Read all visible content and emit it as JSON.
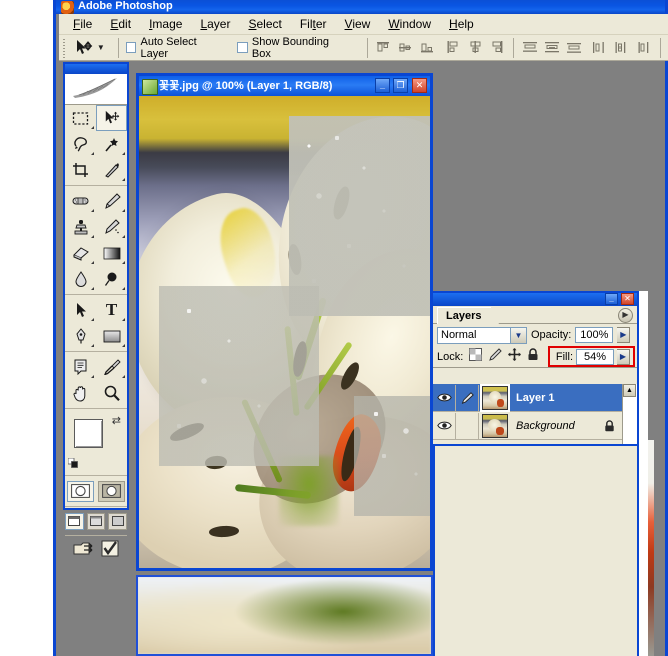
{
  "app": {
    "title": "Adobe Photoshop",
    "icon": "photoshop-logo-icon"
  },
  "menubar": {
    "items": [
      {
        "label": "File",
        "accel": "F"
      },
      {
        "label": "Edit",
        "accel": "E"
      },
      {
        "label": "Image",
        "accel": "I"
      },
      {
        "label": "Layer",
        "accel": "L"
      },
      {
        "label": "Select",
        "accel": "S"
      },
      {
        "label": "Filter",
        "accel": "t"
      },
      {
        "label": "View",
        "accel": "V"
      },
      {
        "label": "Window",
        "accel": "W"
      },
      {
        "label": "Help",
        "accel": "H"
      }
    ]
  },
  "options_bar": {
    "active_tool_icon": "move-tool-icon",
    "preset_caret": "chevron-down-icon",
    "checkboxes": [
      {
        "label": "Auto Select Layer",
        "checked": false
      },
      {
        "label": "Show Bounding Box",
        "checked": false
      }
    ],
    "align_group_1": [
      "align-top-edges",
      "align-vertical-centers",
      "align-bottom-edges"
    ],
    "align_group_2": [
      "align-left-edges",
      "align-horizontal-centers",
      "align-right-edges"
    ],
    "distribute_group_1": [
      "distribute-top-edges",
      "distribute-vertical-centers",
      "distribute-bottom-edges"
    ],
    "distribute_group_2": [
      "distribute-left-edges",
      "distribute-horizontal-centers",
      "distribute-right-edges"
    ]
  },
  "toolbox": {
    "logo_icon": "feather-logo-icon",
    "tools": [
      {
        "name": "marquee-tool",
        "selected": false,
        "hidden_menu": true
      },
      {
        "name": "move-tool",
        "selected": true,
        "hidden_menu": false
      },
      {
        "name": "lasso-tool",
        "selected": false,
        "hidden_menu": true
      },
      {
        "name": "magic-wand-tool",
        "selected": false,
        "hidden_menu": true
      },
      {
        "name": "crop-tool",
        "selected": false,
        "hidden_menu": false
      },
      {
        "name": "slice-tool",
        "selected": false,
        "hidden_menu": true
      },
      {
        "name": "healing-brush-tool",
        "selected": false,
        "hidden_menu": true
      },
      {
        "name": "brush-tool",
        "selected": false,
        "hidden_menu": true
      },
      {
        "name": "clone-stamp-tool",
        "selected": false,
        "hidden_menu": true
      },
      {
        "name": "history-brush-tool",
        "selected": false,
        "hidden_menu": true
      },
      {
        "name": "eraser-tool",
        "selected": false,
        "hidden_menu": true
      },
      {
        "name": "gradient-tool",
        "selected": false,
        "hidden_menu": true
      },
      {
        "name": "blur-tool",
        "selected": false,
        "hidden_menu": true
      },
      {
        "name": "dodge-tool",
        "selected": false,
        "hidden_menu": true
      },
      {
        "name": "path-selection-tool",
        "selected": false,
        "hidden_menu": true
      },
      {
        "name": "type-tool",
        "selected": false,
        "hidden_menu": true
      },
      {
        "name": "pen-tool",
        "selected": false,
        "hidden_menu": true
      },
      {
        "name": "rectangle-tool",
        "selected": false,
        "hidden_menu": true
      },
      {
        "name": "notes-tool",
        "selected": false,
        "hidden_menu": true
      },
      {
        "name": "eyedropper-tool",
        "selected": false,
        "hidden_menu": true
      },
      {
        "name": "hand-tool",
        "selected": false,
        "hidden_menu": false
      },
      {
        "name": "zoom-tool",
        "selected": false,
        "hidden_menu": false
      }
    ],
    "colors": {
      "foreground": "#ffffff",
      "background": "#231008",
      "swap_icon": "swap-colors-icon",
      "default_icon": "default-colors-icon"
    },
    "quickmask": [
      "standard-mode",
      "quick-mask-mode"
    ],
    "screenmode": [
      "standard-screen-mode",
      "full-screen-with-menubar",
      "full-screen-mode"
    ],
    "jump": [
      "jump-to-imageready-icon",
      "check-icon"
    ]
  },
  "document": {
    "title": "꽃꽃.jpg @ 100% (Layer 1, RGB/8)",
    "icon": "document-icon",
    "buttons": {
      "minimize": "_",
      "maximize": "❐",
      "close": "✕"
    }
  },
  "layers_panel": {
    "tab_label": "Layers",
    "menu_arrow_icon": "palette-menu-icon",
    "buttons": {
      "minimize": "_",
      "close": "✕"
    },
    "blend_mode": "Normal",
    "blend_caret_icon": "chevron-down-icon",
    "opacity_label": "Opacity:",
    "opacity_value": "100%",
    "opacity_spin_icon": "spinner-arrow-icon",
    "lock_label": "Lock:",
    "lock_icons": [
      "lock-transparent-pixels-icon",
      "lock-image-pixels-icon",
      "lock-position-icon",
      "lock-all-icon"
    ],
    "fill_label": "Fill:",
    "fill_value": "54%",
    "fill_spin_icon": "spinner-arrow-icon",
    "fill_highlight_color": "#e00000",
    "scroll_up_icon": "scroll-up-arrow-icon",
    "layers": [
      {
        "name": "Layer 1",
        "selected": true,
        "visible": true,
        "eye_icon": "eye-icon",
        "second_icon": "paintbrush-icon",
        "locked": false,
        "italic": false
      },
      {
        "name": "Background",
        "selected": false,
        "visible": true,
        "eye_icon": "eye-icon",
        "second_icon": "",
        "locked": true,
        "lock_icon": "padlock-icon",
        "italic": true
      }
    ]
  },
  "theme": {
    "window_chrome_blue": "#0a46d2",
    "titlebar_blue": "#1060e8",
    "panel_face": "#ece9d8",
    "selection_blue": "#3a6ec0",
    "desktop_grey": "#808080",
    "close_red": "#d1442a"
  }
}
